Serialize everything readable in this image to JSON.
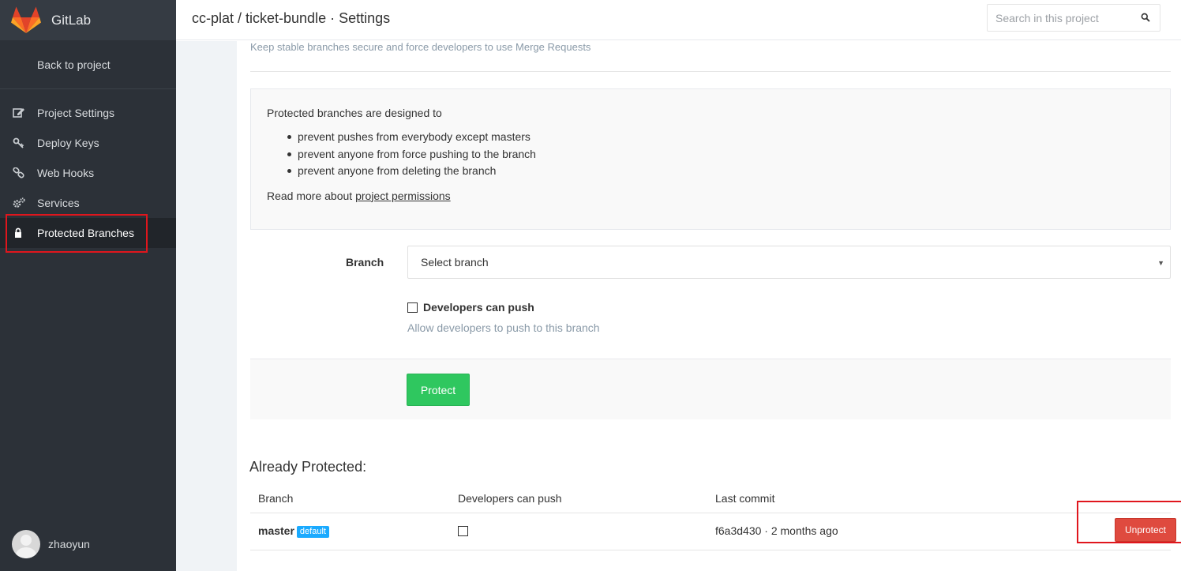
{
  "sidebar": {
    "app_name": "GitLab",
    "back_link": "Back to project",
    "items": [
      {
        "label": "Project Settings",
        "icon": "edit-icon"
      },
      {
        "label": "Deploy Keys",
        "icon": "key-icon"
      },
      {
        "label": "Web Hooks",
        "icon": "link-icon"
      },
      {
        "label": "Services",
        "icon": "cogs-icon"
      },
      {
        "label": "Protected Branches",
        "icon": "lock-icon",
        "active": true
      }
    ],
    "username": "zhaoyun"
  },
  "header": {
    "title": "cc-plat / ticket-bundle · Settings",
    "search_placeholder": "Search in this project"
  },
  "main": {
    "subtitle": "Keep stable branches secure and force developers to use Merge Requests",
    "info": {
      "intro": "Protected branches are designed to",
      "bullets": [
        "prevent pushes from everybody except masters",
        "prevent anyone from force pushing to the branch",
        "prevent anyone from deleting the branch"
      ],
      "more_prefix": "Read more about",
      "more_link": "project permissions"
    },
    "form": {
      "branch_label": "Branch",
      "branch_select_value": "Select branch",
      "dev_push_label": "Developers can push",
      "dev_push_help": "Allow developers to push to this branch",
      "dev_push_checked": false,
      "protect_button": "Protect"
    },
    "protected": {
      "heading": "Already Protected:",
      "columns": [
        "Branch",
        "Developers can push",
        "Last commit"
      ],
      "rows": [
        {
          "branch": "master",
          "badge": "default",
          "dev_push": false,
          "last_commit": "f6a3d430 · 2 months ago",
          "action": "Unprotect"
        }
      ]
    }
  },
  "colors": {
    "sidebar_bg": "#2c3138",
    "protect_green": "#2fc75f",
    "unprotect_red": "#df4a3f",
    "badge_blue": "#1aaaff",
    "highlight_red": "#e0161d"
  }
}
